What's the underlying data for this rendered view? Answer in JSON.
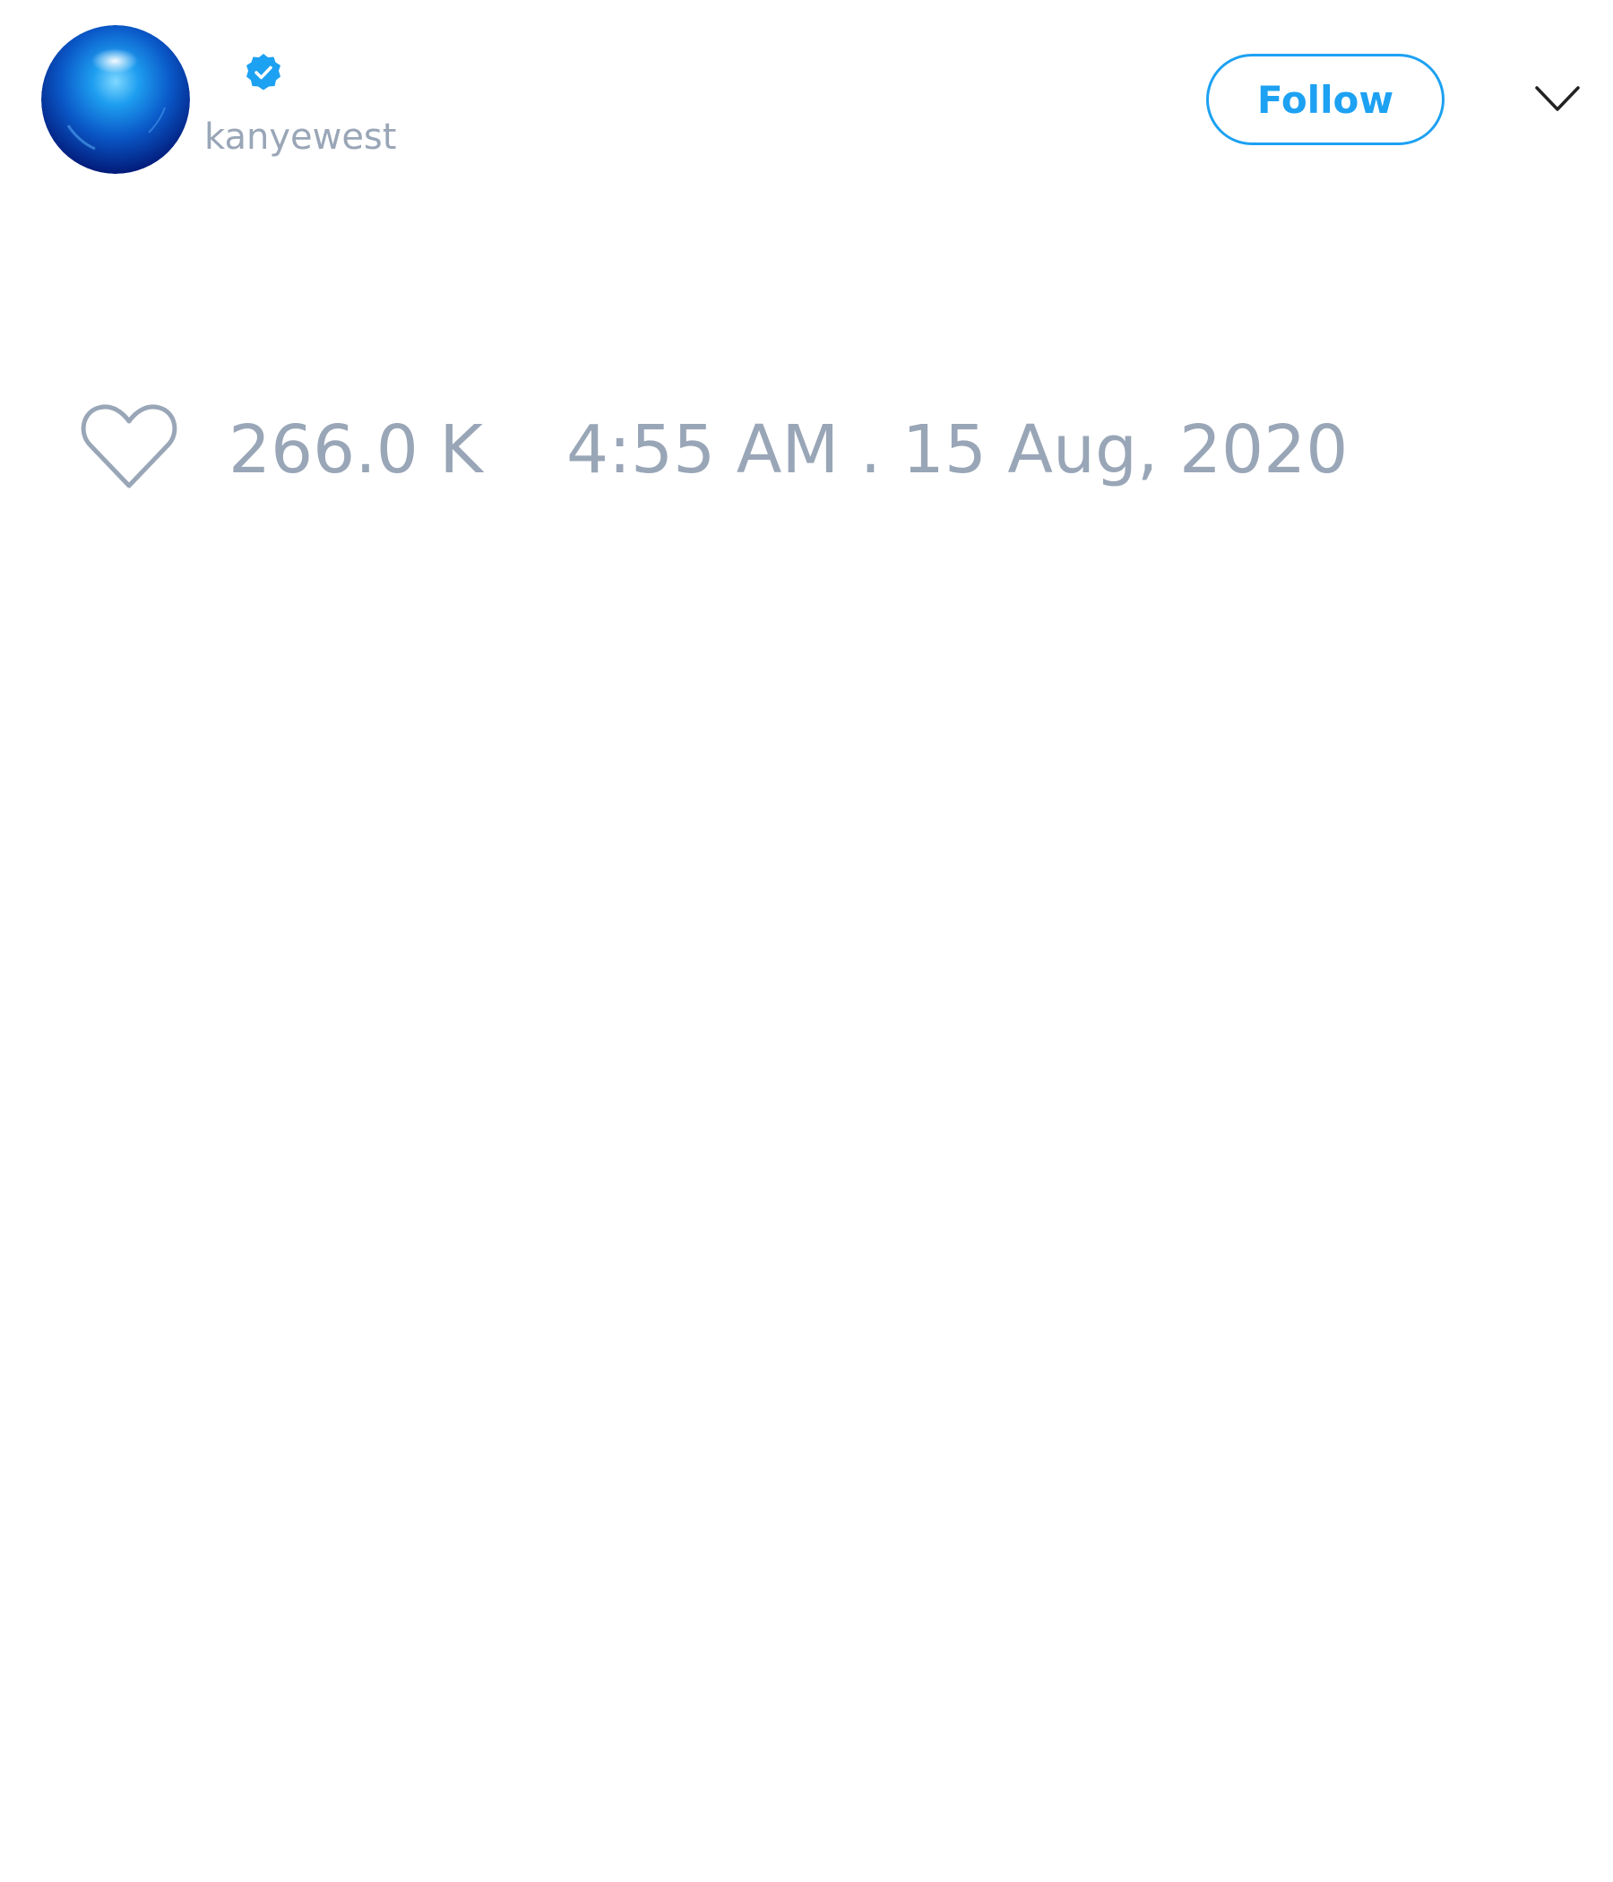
{
  "profile": {
    "username": "kanyewest",
    "avatar_icon": "blue-sphere-avatar",
    "verified_icon": "verified-badge-icon"
  },
  "header": {
    "follow_label": "Follow",
    "menu_icon": "chevron-down-icon"
  },
  "stats": {
    "like_icon": "heart-outline-icon",
    "likes": "266.0 K",
    "timestamp": "4:55 AM . 15 Aug, 2020"
  },
  "colors": {
    "accent": "#1da1f2",
    "muted_text": "#99a6b7",
    "background": "#ffffff"
  }
}
